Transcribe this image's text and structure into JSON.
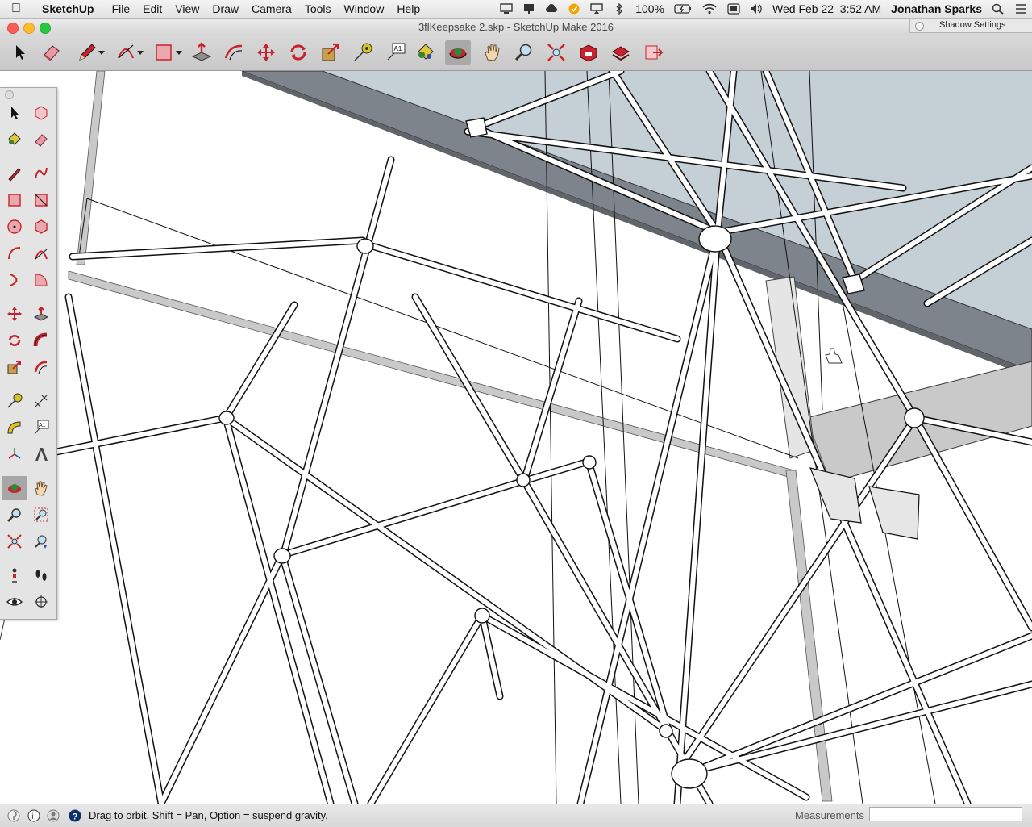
{
  "menubar": {
    "app_name": "SketchUp",
    "items": [
      "File",
      "Edit",
      "View",
      "Draw",
      "Camera",
      "Tools",
      "Window",
      "Help"
    ],
    "battery": "100%",
    "datetime": "Wed Feb 22  3:52 AM",
    "user": "Jonathan Sparks"
  },
  "window": {
    "title": "3flKeepsake 2.skp - SketchUp Make 2016"
  },
  "shadow_panel": {
    "title": "Shadow Settings"
  },
  "toolbar": {
    "tools": [
      "select-tool",
      "eraser-tool",
      "pencil-tool",
      "arc-tool",
      "shapes-tool",
      "push-pull-tool",
      "offset-tool",
      "move-tool",
      "rotate-tool",
      "scale-tool",
      "tape-measure-tool",
      "text-tool",
      "paint-bucket-tool",
      "orbit-tool",
      "pan-tool",
      "zoom-tool",
      "zoom-extents-tool",
      "warehouse-tool",
      "extension-warehouse-tool",
      "layout-tool"
    ],
    "active": "orbit-tool"
  },
  "palette": {
    "text_tool_label": "A1"
  },
  "statusbar": {
    "hint": "Drag to orbit. Shift = Pan, Option = suspend gravity.",
    "measurements_label": "Measurements",
    "measurements_value": ""
  },
  "colors": {
    "accent_red": "#c8232c",
    "ceiling_blue": "#c4cfd6",
    "beam_gray": "#7d848c"
  }
}
